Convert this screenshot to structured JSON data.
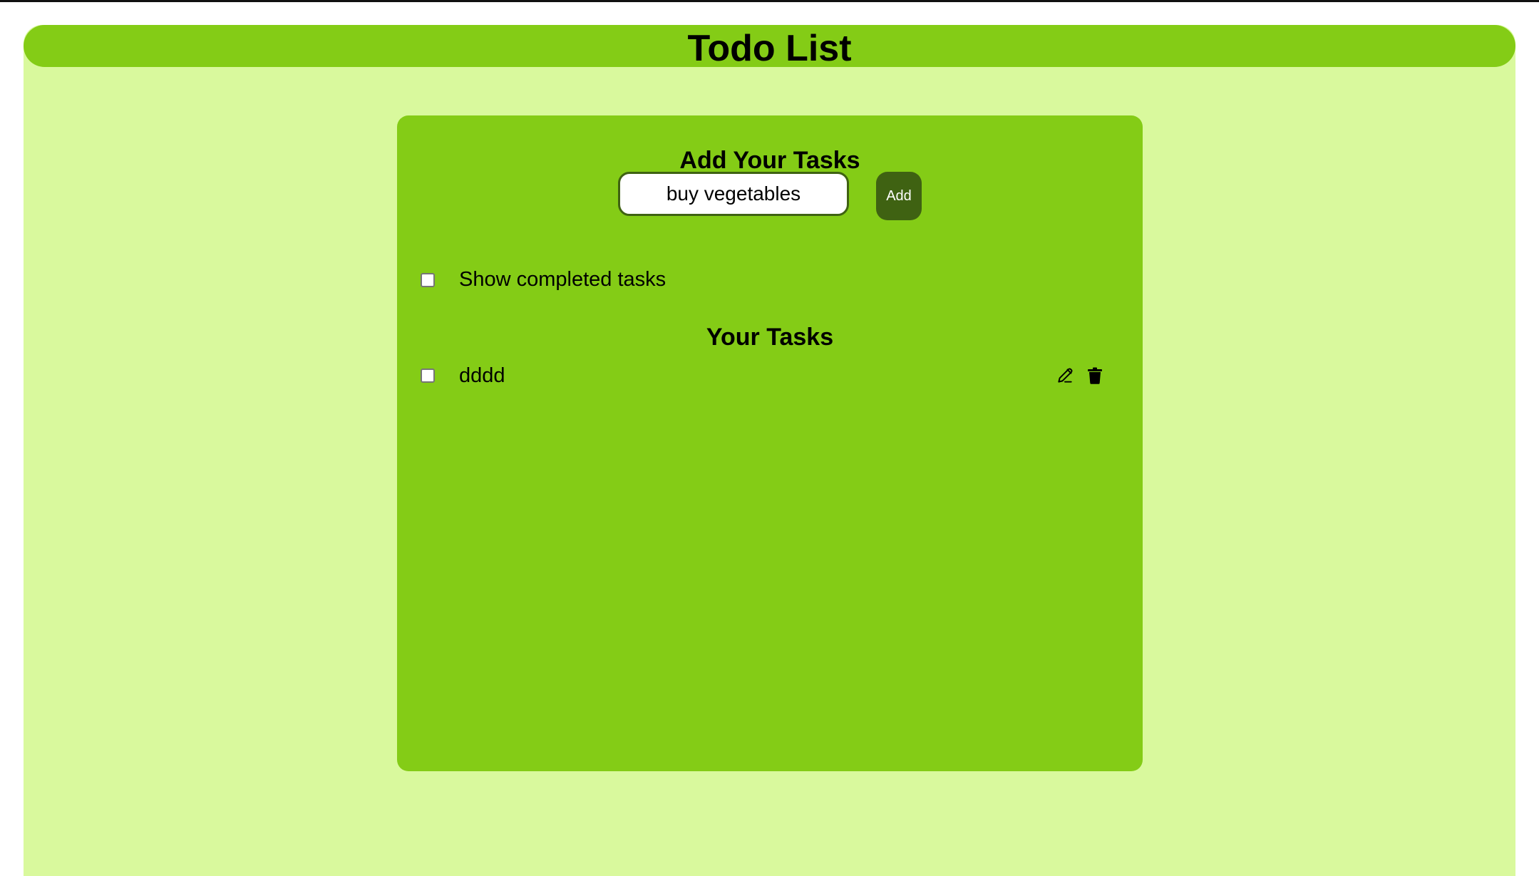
{
  "header": {
    "title": "Todo List"
  },
  "add_section": {
    "heading": "Add Your Tasks",
    "input_value": "buy vegetables",
    "add_label": "Add"
  },
  "filters": {
    "show_completed_label": "Show completed tasks",
    "show_completed_checked": false
  },
  "tasks_section": {
    "heading": "Your Tasks",
    "items": [
      {
        "label": "dddd",
        "completed": false,
        "actions": [
          "edit-icon",
          "trash-icon"
        ]
      }
    ]
  },
  "colors": {
    "page_background": "#d9f99d",
    "accent": "#84cc16",
    "button": "#3f6212",
    "button_text": "#ffffff"
  }
}
